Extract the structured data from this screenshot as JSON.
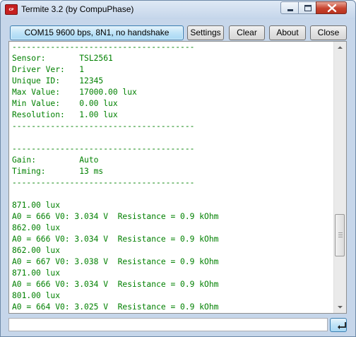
{
  "window": {
    "title": "Termite 3.2 (by CompuPhase)",
    "app_icon_text": "ᴄᴘ",
    "accent_color": "#3c7fb1",
    "text_color": "#008000"
  },
  "toolbar": {
    "status_label": "COM15 9600 bps, 8N1, no handshake",
    "settings_label": "Settings",
    "clear_label": "Clear",
    "about_label": "About",
    "close_label": "Close"
  },
  "terminal": {
    "lines": [
      "--------------------------------------",
      "Sensor:       TSL2561",
      "Driver Ver:   1",
      "Unique ID:    12345",
      "Max Value:    17000.00 lux",
      "Min Value:    0.00 lux",
      "Resolution:   1.00 lux",
      "--------------------------------------",
      "",
      "--------------------------------------",
      "Gain:         Auto",
      "Timing:       13 ms",
      "--------------------------------------",
      "",
      "871.00 lux",
      "A0 = 666 V0: 3.034 V  Resistance = 0.9 kOhm",
      "862.00 lux",
      "A0 = 666 V0: 3.034 V  Resistance = 0.9 kOhm",
      "862.00 lux",
      "A0 = 667 V0: 3.038 V  Resistance = 0.9 kOhm",
      "871.00 lux",
      "A0 = 666 V0: 3.034 V  Resistance = 0.9 kOhm",
      "801.00 lux",
      "A0 = 664 V0: 3.025 V  Resistance = 0.9 kOhm"
    ]
  },
  "input": {
    "value": "",
    "enter_icon": "enter-icon"
  }
}
